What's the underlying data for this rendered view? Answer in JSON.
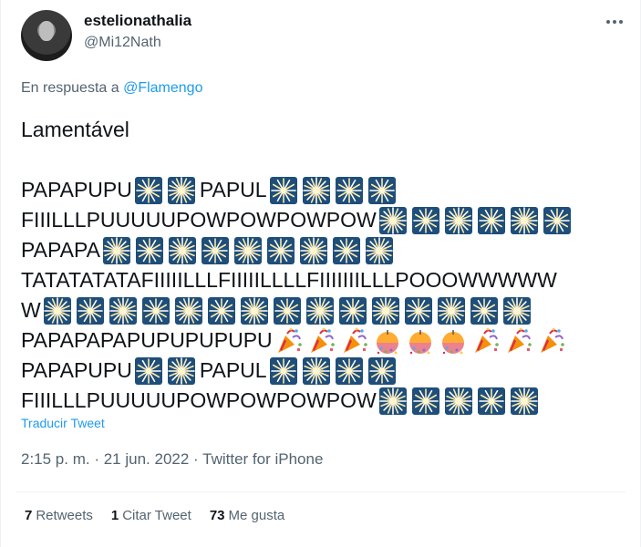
{
  "author": {
    "display_name": "estelionathalia",
    "handle": "@Mi12Nath"
  },
  "reply": {
    "prefix": "En respuesta a",
    "mention": "@Flamengo"
  },
  "tweet": {
    "title_line": "Lamentável",
    "lines": [
      [
        {
          "t": "PAPAPUPU"
        },
        {
          "e": "sparkler"
        },
        {
          "e": "fireworks"
        },
        {
          "t": "PAPUL"
        },
        {
          "e": "sparkler"
        },
        {
          "e": "fireworks"
        },
        {
          "e": "sparkler"
        },
        {
          "e": "sparkler"
        }
      ],
      [
        {
          "t": "FIIILLLPUUUUUPOWPOWPOWPOW"
        },
        {
          "e": "fireworks"
        },
        {
          "e": "sparkler"
        },
        {
          "e": "fireworks"
        },
        {
          "e": "sparkler"
        },
        {
          "e": "fireworks"
        },
        {
          "e": "sparkler"
        }
      ],
      [
        {
          "t": "PAPAPA"
        },
        {
          "e": "fireworks"
        },
        {
          "e": "sparkler"
        },
        {
          "e": "fireworks"
        },
        {
          "e": "sparkler"
        },
        {
          "e": "fireworks"
        },
        {
          "e": "sparkler"
        },
        {
          "e": "fireworks"
        },
        {
          "e": "sparkler"
        },
        {
          "e": "fireworks"
        }
      ],
      [
        {
          "t": "TATATATATAFIIIIILLLFIIIIILLLLFIIIIIIILLLPOOOWWWWW"
        }
      ],
      [
        {
          "t": "W"
        },
        {
          "e": "fireworks"
        },
        {
          "e": "sparkler"
        },
        {
          "e": "fireworks"
        },
        {
          "e": "sparkler"
        },
        {
          "e": "fireworks"
        },
        {
          "e": "sparkler"
        },
        {
          "e": "fireworks"
        },
        {
          "e": "sparkler"
        },
        {
          "e": "fireworks"
        },
        {
          "e": "sparkler"
        },
        {
          "e": "fireworks"
        },
        {
          "e": "sparkler"
        },
        {
          "e": "fireworks"
        },
        {
          "e": "sparkler"
        },
        {
          "e": "fireworks"
        }
      ],
      [
        {
          "t": "PAPAPAPAPUPUPUPUPU"
        },
        {
          "e": "party-popper"
        },
        {
          "e": "party-popper"
        },
        {
          "e": "party-popper"
        },
        {
          "e": "confetti-ball"
        },
        {
          "e": "confetti-ball"
        },
        {
          "e": "confetti-ball"
        },
        {
          "e": "party-popper"
        },
        {
          "e": "party-popper"
        },
        {
          "e": "party-popper"
        }
      ],
      [
        {
          "t": "PAPAPUPU"
        },
        {
          "e": "sparkler"
        },
        {
          "e": "fireworks"
        },
        {
          "t": "PAPUL"
        },
        {
          "e": "sparkler"
        },
        {
          "e": "fireworks"
        },
        {
          "e": "sparkler"
        },
        {
          "e": "sparkler"
        }
      ],
      [
        {
          "t": "FIIILLLPUUUUUPOWPOWPOWPOW"
        },
        {
          "e": "fireworks"
        },
        {
          "e": "sparkler"
        },
        {
          "e": "fireworks"
        },
        {
          "e": "sparkler"
        },
        {
          "e": "fireworks"
        }
      ]
    ]
  },
  "translate_label": "Traducir Tweet",
  "meta": {
    "time": "2:15 p. m.",
    "separator": " · ",
    "date": "21 jun. 2022",
    "source": "Twitter for iPhone"
  },
  "stats": {
    "retweets": {
      "count": "7",
      "label": "Retweets"
    },
    "quotes": {
      "count": "1",
      "label": "Citar Tweet"
    },
    "likes": {
      "count": "73",
      "label": "Me gusta"
    }
  },
  "colors": {
    "accent": "#1d9bf0",
    "secondary_text": "#536471",
    "emoji_tile": "#1e4e79"
  }
}
